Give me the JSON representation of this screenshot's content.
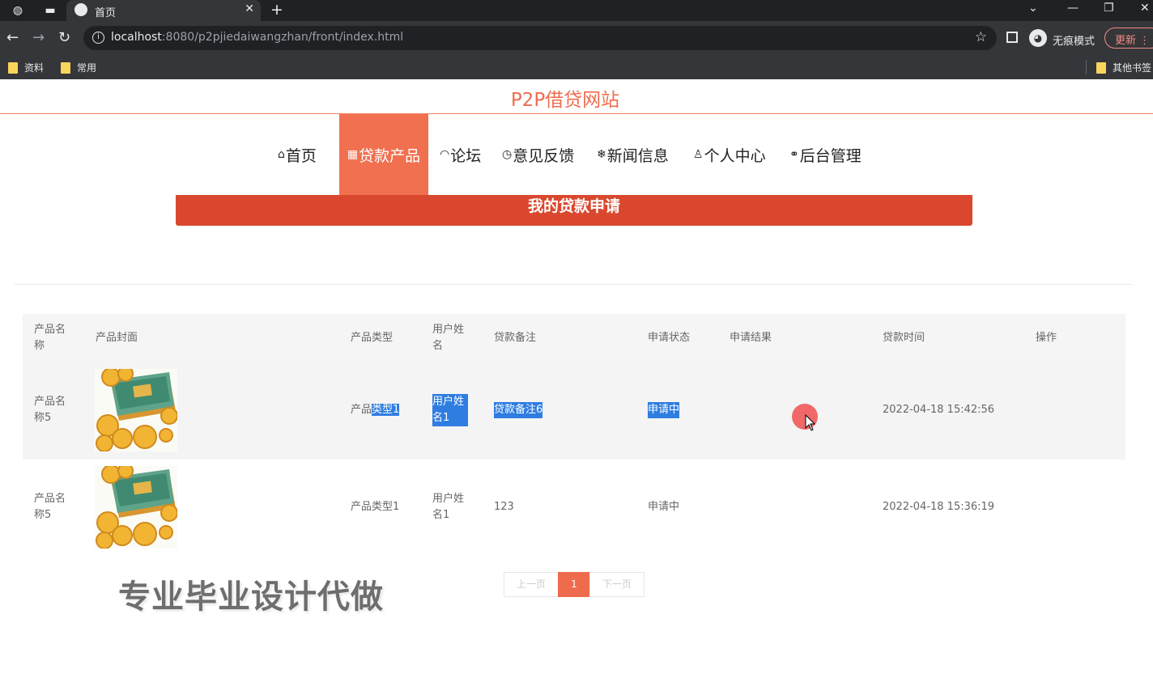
{
  "browser": {
    "tab_title": "首页",
    "url_host": "localhost",
    "url_rest": ":8080/p2pjiedaiwangzhan/front/index.html",
    "incognito_label": "无痕模式",
    "update_label": "更新",
    "bookmarks": [
      "资料",
      "常用"
    ],
    "other_bookmarks": "其他书签"
  },
  "site": {
    "title": "P2P借贷网站",
    "nav": [
      {
        "icon": "⌂",
        "label": "首页"
      },
      {
        "icon": "▦",
        "label": "贷款产品"
      },
      {
        "icon": "◠",
        "label": "论坛"
      },
      {
        "icon": "◷",
        "label": "意见反馈"
      },
      {
        "icon": "❄",
        "label": "新闻信息"
      },
      {
        "icon": "♙",
        "label": "个人中心"
      },
      {
        "icon": "⚭",
        "label": "后台管理"
      }
    ],
    "active_nav": "贷款产品",
    "banner": "我的贷款申请"
  },
  "table": {
    "headers": [
      "产品名称",
      "产品封面",
      "产品类型",
      "用户姓名",
      "贷款备注",
      "申请状态",
      "申请结果",
      "贷款时间",
      "操作"
    ],
    "rows": [
      {
        "name": "产品名称5",
        "type_prefix": "产品",
        "type_sel": "类型1",
        "user": "用户姓名1",
        "note": "贷款备注6",
        "status": "申请中",
        "result": "",
        "time": "2022-04-18 15:42:56",
        "op": ""
      },
      {
        "name": "产品名称5",
        "type_prefix": "产品类型1",
        "type_sel": "",
        "user": "用户姓名1",
        "note": "123",
        "status": "申请中",
        "result": "",
        "time": "2022-04-18 15:36:19",
        "op": ""
      }
    ]
  },
  "pager": {
    "prev": "上一页",
    "current": "1",
    "next": "下一页"
  },
  "watermark": "专业毕业设计代做",
  "colors": {
    "accent": "#ee6c4d",
    "banner": "#d9482e",
    "selection": "#2f7de1"
  }
}
